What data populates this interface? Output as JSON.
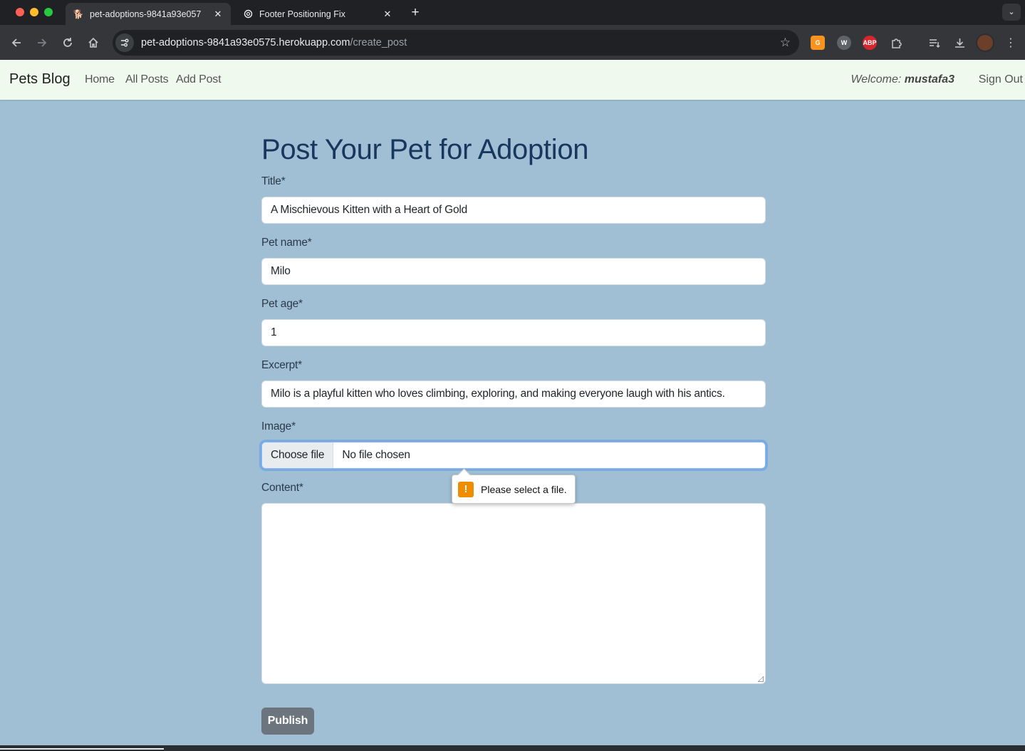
{
  "browser": {
    "tabs": [
      {
        "title": "pet-adoptions-9841a93e057",
        "icon": "dog-favicon",
        "active": true
      },
      {
        "title": "Footer Positioning Fix",
        "icon": "openai-favicon",
        "active": false
      }
    ],
    "new_tab_label": "+",
    "url_host": "pet-adoptions-9841a93e0575.herokuapp.com",
    "url_path": "/create_post",
    "extensions": [
      "grammarly-icon",
      "wordtune-icon",
      "adblock-plus-icon",
      "puzzle-icon"
    ],
    "extension_labels": {
      "abp": "ABP"
    }
  },
  "navbar": {
    "brand": "Pets Blog",
    "links": [
      "Home",
      "All Posts",
      "Add Post"
    ],
    "welcome_prefix": "Welcome: ",
    "username": "mustafa3",
    "sign_out": "Sign Out"
  },
  "form": {
    "heading": "Post Your Pet for Adoption",
    "title_label": "Title*",
    "title_value": "A Mischievous Kitten with a Heart of Gold",
    "pet_name_label": "Pet name*",
    "pet_name_value": "Milo",
    "pet_age_label": "Pet age*",
    "pet_age_value": "1",
    "excerpt_label": "Excerpt*",
    "excerpt_value": "Milo is a playful kitten who loves climbing, exploring, and making everyone laugh with his antics.",
    "image_label": "Image*",
    "choose_file": "Choose file",
    "no_file": "No file chosen",
    "content_label": "Content*",
    "content_value": "",
    "publish": "Publish"
  },
  "validation": {
    "message": "Please select a file.",
    "icon_glyph": "!"
  },
  "colors": {
    "page_bg": "#a0bfd4",
    "navbar_bg": "#f0f9ee",
    "heading": "#17375e",
    "publish_bg": "#6c757d",
    "warning": "#f08c00"
  }
}
